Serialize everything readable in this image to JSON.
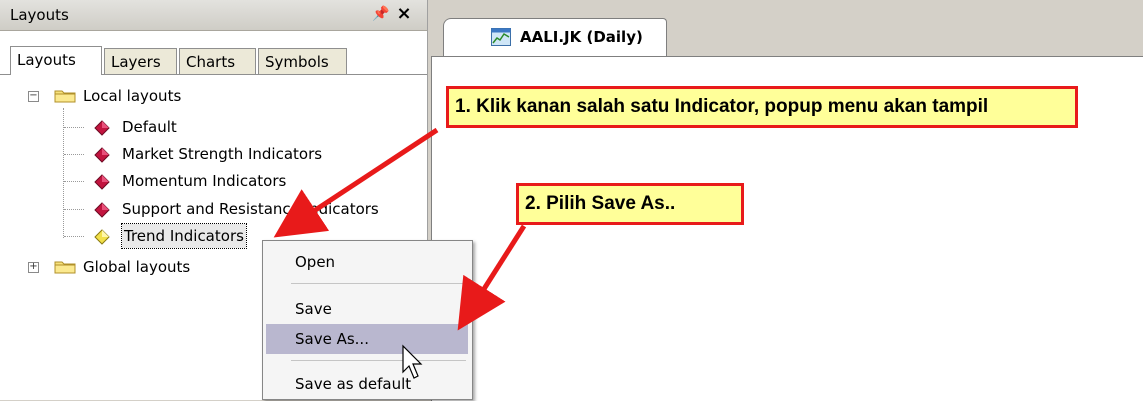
{
  "panel": {
    "title": "Layouts",
    "pin_glyph": "†",
    "close_glyph": "×",
    "tabs": [
      {
        "label": "Layouts",
        "active": true
      },
      {
        "label": "Layers",
        "active": false
      },
      {
        "label": "Charts",
        "active": false
      },
      {
        "label": "Symbols",
        "active": false
      }
    ]
  },
  "tree": {
    "local_layouts": {
      "label": "Local layouts",
      "expander": "−",
      "items": [
        {
          "label": "Default",
          "icon": "red-gem-icon"
        },
        {
          "label": "Market Strength Indicators",
          "icon": "red-gem-icon"
        },
        {
          "label": "Momentum Indicators",
          "icon": "red-gem-icon"
        },
        {
          "label": "Support and Resistance Indicators",
          "icon": "red-gem-icon"
        },
        {
          "label": "Trend Indicators",
          "icon": "yellow-gem-icon",
          "selected": true
        }
      ]
    },
    "global_layouts": {
      "label": "Global layouts",
      "expander": "+"
    }
  },
  "document": {
    "tab_label": "AALI.JK (Daily)",
    "tab_icon": "chart-icon"
  },
  "context_menu": {
    "items": [
      {
        "label": "Open"
      },
      {
        "label": "Save"
      },
      {
        "label": "Save As...",
        "highlighted": true
      },
      {
        "label": "Save as default"
      }
    ]
  },
  "annotations": {
    "step1": "1. Klik kanan salah satu Indicator, popup menu akan tampil",
    "step2": "2. Pilih Save As..",
    "colors": {
      "callout_fill": "#ffff99",
      "callout_border": "#e81a1a",
      "arrow": "#e81a1a"
    }
  }
}
